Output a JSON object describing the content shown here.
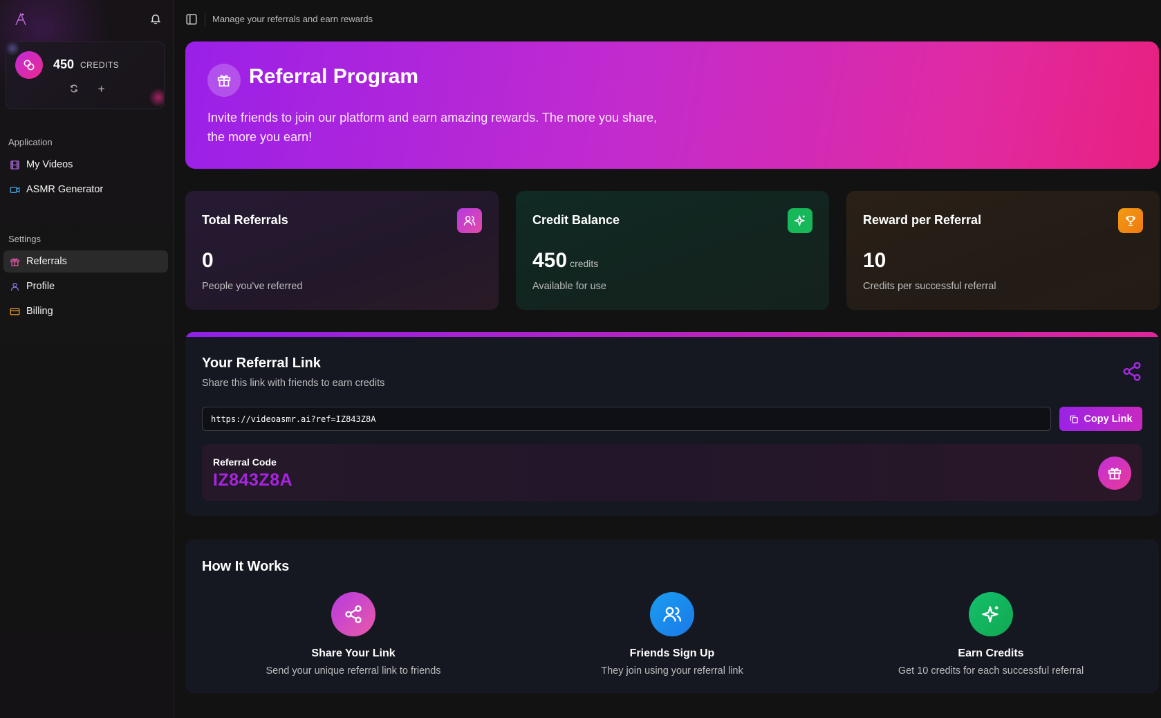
{
  "topbar": {
    "subtitle": "Manage your referrals and earn rewards"
  },
  "sidebar": {
    "credits": {
      "amount": "450",
      "label": "CREDITS"
    },
    "sections": [
      {
        "label": "Application",
        "items": [
          {
            "label": "My Videos",
            "icon": "film-icon"
          },
          {
            "label": "ASMR Generator",
            "icon": "video-camera-icon"
          }
        ]
      },
      {
        "label": "Settings",
        "items": [
          {
            "label": "Referrals",
            "icon": "gift-icon",
            "active": true
          },
          {
            "label": "Profile",
            "icon": "user-icon"
          },
          {
            "label": "Billing",
            "icon": "credit-card-icon"
          }
        ]
      }
    ]
  },
  "hero": {
    "title": "Referral Program",
    "description": "Invite friends to join our platform and earn amazing rewards. The more you share, the more you earn!"
  },
  "stats": [
    {
      "title": "Total Referrals",
      "value": "0",
      "unit": "",
      "subtitle": "People you've referred",
      "icon": "users-icon",
      "color": "#c63cd8"
    },
    {
      "title": "Credit Balance",
      "value": "450",
      "unit": "credits",
      "subtitle": "Available for use",
      "icon": "sparkles-icon",
      "color": "#16b85a"
    },
    {
      "title": "Reward per Referral",
      "value": "10",
      "unit": "",
      "subtitle": "Credits per successful referral",
      "icon": "trophy-icon",
      "color": "#f28a12"
    }
  ],
  "referral_link": {
    "title": "Your Referral Link",
    "subtitle": "Share this link with friends to earn credits",
    "url": "https://videoasmr.ai?ref=IZ843Z8A",
    "copy_label": "Copy Link",
    "code_label": "Referral Code",
    "code": "IZ843Z8A"
  },
  "how_it_works": {
    "title": "How It Works",
    "steps": [
      {
        "title": "Share Your Link",
        "description": "Send your unique referral link to friends",
        "icon": "share-icon"
      },
      {
        "title": "Friends Sign Up",
        "description": "They join using your referral link",
        "icon": "users-icon"
      },
      {
        "title": "Earn Credits",
        "description": "Get 10 credits for each successful referral",
        "icon": "sparkles-icon"
      }
    ]
  },
  "colors": {
    "accent_purple": "#9b22e6",
    "accent_pink": "#e0249a"
  }
}
